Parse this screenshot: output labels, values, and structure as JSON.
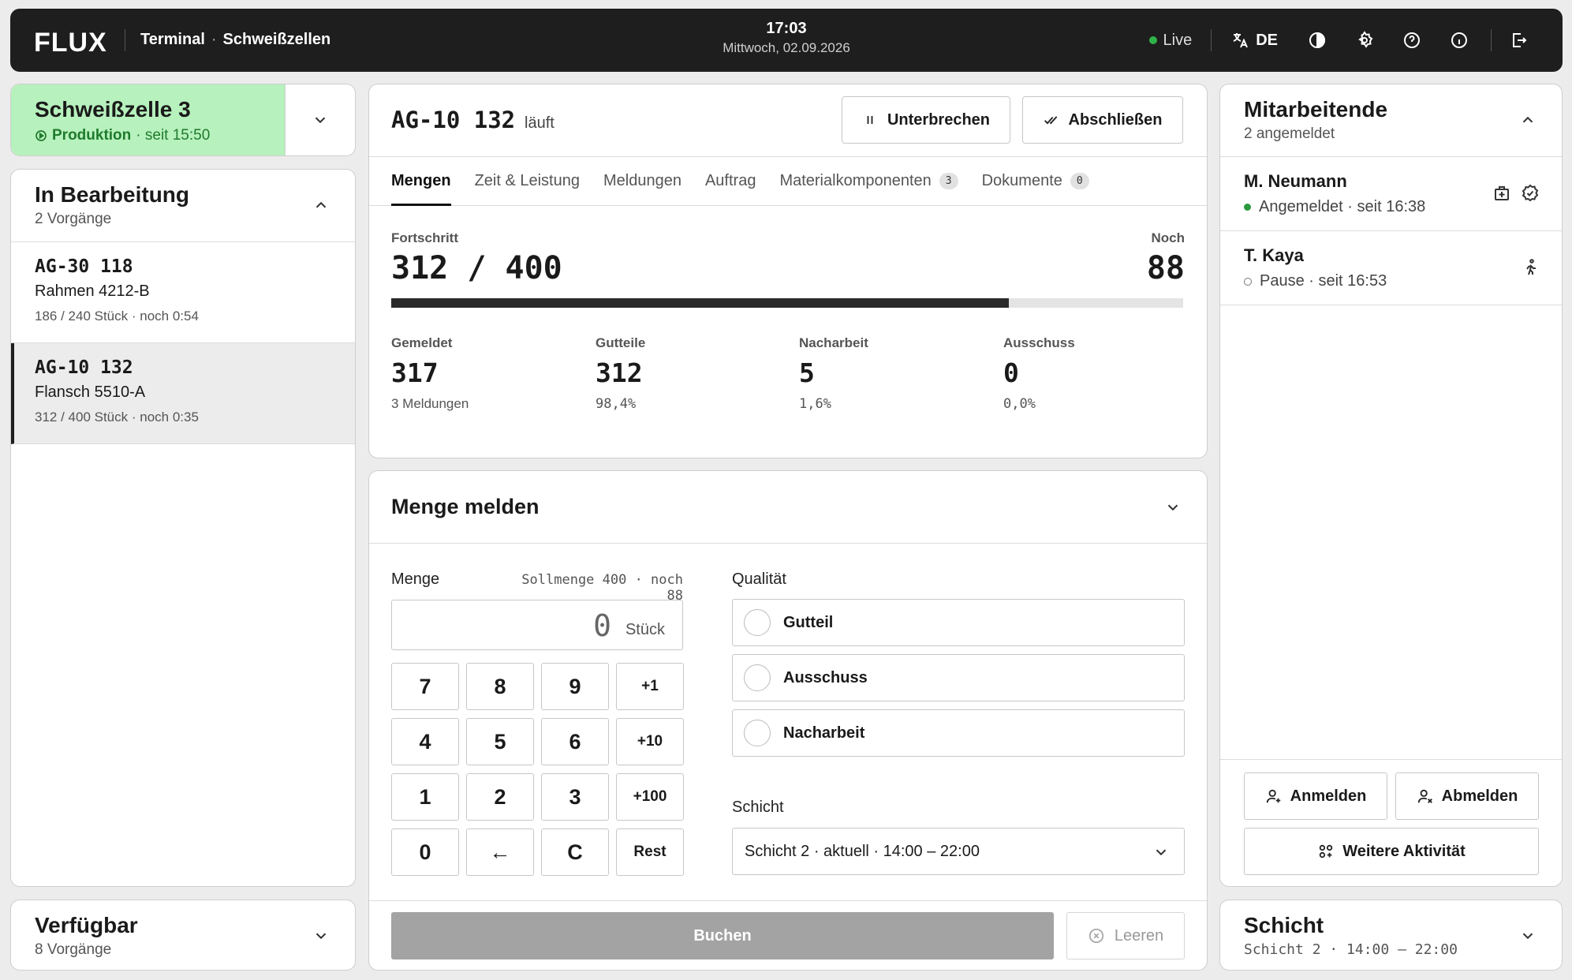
{
  "topbar": {
    "logo": "FLUX",
    "crumb_app": "Terminal",
    "crumb_page": "Schweißzellen",
    "time": "17:03",
    "date": "Mittwoch, 02.09.2026",
    "live_label": "Live",
    "language": "DE"
  },
  "cell": {
    "title": "Schweißzelle 3",
    "status_label": "Produktion",
    "status_since": "· seit 15:50",
    "status_color": "#b7f1bd"
  },
  "in_progress": {
    "title": "In Bearbeitung",
    "subtitle": "2 Vorgänge",
    "orders": [
      {
        "id": "AG-30 118",
        "name": "Rahmen 4212-B",
        "meta": "186 / 240 Stück · noch 0:54"
      },
      {
        "id": "AG-10 132",
        "name": "Flansch 5510-A",
        "meta": "312 / 400 Stück · noch 0:35"
      }
    ]
  },
  "available": {
    "title": "Verfügbar",
    "subtitle": "8 Vorgänge"
  },
  "job": {
    "id": "AG-10 132",
    "state": "läuft",
    "pause_label": "Unterbrechen",
    "finish_label": "Abschließen",
    "tabs": [
      {
        "label": "Mengen",
        "badge": ""
      },
      {
        "label": "Zeit & Leistung",
        "badge": ""
      },
      {
        "label": "Meldungen",
        "badge": ""
      },
      {
        "label": "Auftrag",
        "badge": ""
      },
      {
        "label": "Materialkomponenten",
        "badge": "3"
      },
      {
        "label": "Dokumente",
        "badge": "0"
      }
    ],
    "progress_label": "Fortschritt",
    "progress_value": "312 / 400",
    "progress_fraction": 0.78,
    "remaining_label": "Noch",
    "remaining_value": "88",
    "stats": [
      {
        "label": "Gemeldet",
        "value": "317",
        "sub": "3 Meldungen"
      },
      {
        "label": "Gutteile",
        "value": "312",
        "sub": "98,4%"
      },
      {
        "label": "Nacharbeit",
        "value": "5",
        "sub": "1,6%"
      },
      {
        "label": "Ausschuss",
        "value": "0",
        "sub": "0,0%"
      }
    ]
  },
  "report": {
    "title": "Menge melden",
    "qty_label": "Menge",
    "target_info": "Sollmenge 400 · noch 88",
    "qty_value": "0",
    "qty_unit": "Stück",
    "keys": [
      "7",
      "8",
      "9",
      "+1",
      "4",
      "5",
      "6",
      "+10",
      "1",
      "2",
      "3",
      "+100",
      "0",
      "←",
      "C",
      "Rest"
    ],
    "quality_label": "Qualität",
    "quality_options": [
      "Gutteil",
      "Ausschuss",
      "Nacharbeit"
    ],
    "shift_label": "Schicht",
    "shift_value": "Schicht 2 · aktuell · 14:00 – 22:00",
    "book_label": "Buchen",
    "clear_label": "Leeren"
  },
  "employees": {
    "title": "Mitarbeitende",
    "subtitle": "2 angemeldet",
    "list": [
      {
        "name": "M. Neumann",
        "status": "Angemeldet · seit 16:38"
      },
      {
        "name": "T. Kaya",
        "status": "Pause · seit 16:53"
      }
    ],
    "login_label": "Anmelden",
    "logout_label": "Abmelden",
    "more_label": "Weitere Aktivität"
  },
  "shift": {
    "title": "Schicht",
    "subtitle": "Schicht 2 · 14:00 – 22:00"
  }
}
